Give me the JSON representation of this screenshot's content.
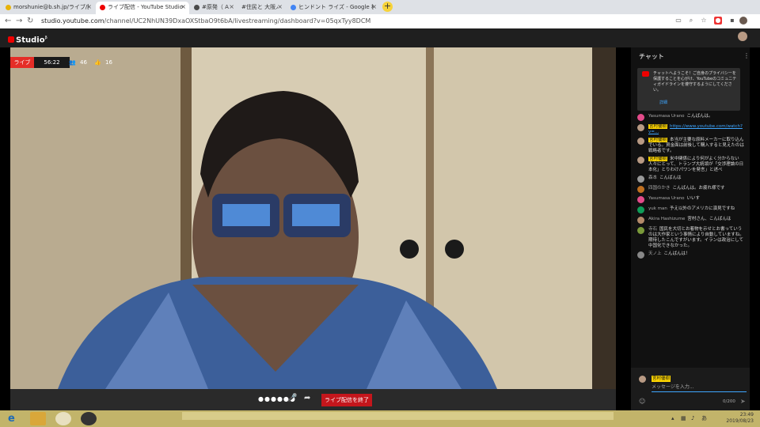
{
  "browser": {
    "tabs": [
      {
        "label": "morshunie@b.sh.jp/ライブ/配信"
      },
      {
        "label": "ライブ配信 - YouTube Studio"
      },
      {
        "label": "#原発（ A"
      },
      {
        "label": "#住民と 大阪人"
      },
      {
        "label": "ヒンドント ライズ - Google 検索"
      }
    ],
    "url_host": "studio.youtube.com",
    "url_path": "/channel/UC2NhUN39DxaOXStbaO9t6bA/livestreaming/dashboard?v=05qxTyy8DCM"
  },
  "studio": {
    "logo_text": "Studio",
    "logo_suffix": "β"
  },
  "stream": {
    "live_label": "ライブ",
    "elapsed": "56:22",
    "viewers": "46",
    "likes": "16",
    "end_button": "ライブ配信を終了"
  },
  "chat": {
    "title": "チャット",
    "notice": "チャットへようこそ！ご自身のプライバシーを保護することを心がけ、YouTubeのコミュニティガイドラインを遵守するようにしてください。",
    "notice_link": "詳細",
    "messages": [
      {
        "author": "Yasumasa Urano",
        "text": "こんばんは。",
        "highlight": false,
        "avatar": "#e34b8a"
      },
      {
        "author": "宮村優樹",
        "text": "https://www.youtube.com/watch?v=...",
        "link": true,
        "highlight": true,
        "avatar": "#b89a84"
      },
      {
        "author": "宮村優樹",
        "text": "本当が主要な原料メーカーに取り込んでいる。資金面は前後して購入すると見えたのは戦略者です。",
        "highlight": true,
        "avatar": "#b89a84"
      },
      {
        "author": "宮村優樹",
        "text": "米中関係により何がよく分からない人々にとって、トランプ大統領が「交渉理論の日本化」とりわけパワンを発言」と述べ",
        "highlight": true,
        "avatar": "#b89a84"
      },
      {
        "author": "森本",
        "text": "こんばんは",
        "highlight": false,
        "avatar": "#9a9a9a"
      },
      {
        "author": "四国のかき",
        "text": "こんばんは。お疲れ様です",
        "highlight": false,
        "avatar": "#c07020"
      },
      {
        "author": "Yasumasa Urano",
        "text": "いいす",
        "highlight": false,
        "avatar": "#e34b8a"
      },
      {
        "author": "yuk man",
        "text": "予え以外のアメリカに演見ですね",
        "highlight": false,
        "avatar": "#0f9d58"
      },
      {
        "author": "Akira Hashizume",
        "text": "宮村さん、こんばんは",
        "highlight": false,
        "avatar": "#b48a6a"
      },
      {
        "author": "寺石",
        "text": "国民を大切とお着物を示せとお書っていうのは大作家という事情により自動していますね。期待したこんですがいます。イランは政治にして中国化できなかった。",
        "highlight": false,
        "avatar": "#7a9a3a"
      },
      {
        "author": "天ノ上",
        "text": "こんばんは！",
        "highlight": false,
        "avatar": "#888888"
      }
    ],
    "input_author": "宮村優樹",
    "input_placeholder": "メッセージを入力...",
    "char_count": "0/200"
  },
  "taskbar": {
    "time": "23:49",
    "date": "2019/08/23"
  }
}
